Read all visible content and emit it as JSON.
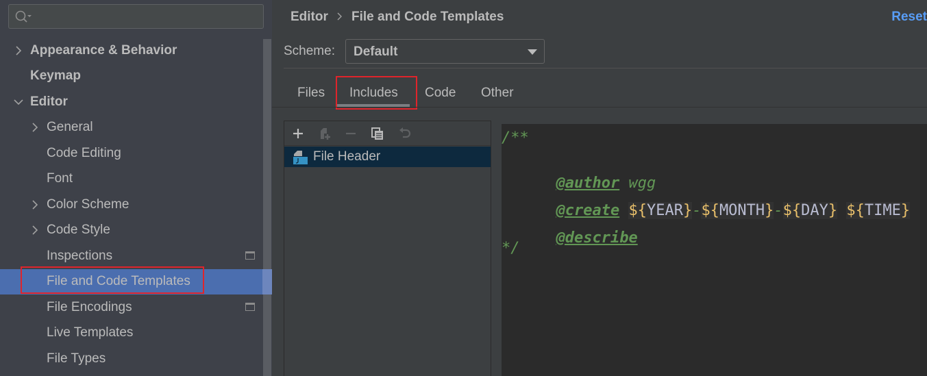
{
  "sidebar": {
    "search": {
      "placeholder": "",
      "value": ""
    },
    "items": [
      {
        "label": "Appearance & Behavior",
        "level": 0,
        "expandable": true,
        "expanded": false,
        "bold": true
      },
      {
        "label": "Keymap",
        "level": 0,
        "expandable": false,
        "bold": true
      },
      {
        "label": "Editor",
        "level": 0,
        "expandable": true,
        "expanded": true,
        "bold": true
      },
      {
        "label": "General",
        "level": 1,
        "expandable": true,
        "expanded": false
      },
      {
        "label": "Code Editing",
        "level": 1,
        "expandable": false
      },
      {
        "label": "Font",
        "level": 1,
        "expandable": false
      },
      {
        "label": "Color Scheme",
        "level": 1,
        "expandable": true,
        "expanded": false
      },
      {
        "label": "Code Style",
        "level": 1,
        "expandable": true,
        "expanded": false
      },
      {
        "label": "Inspections",
        "level": 1,
        "expandable": false,
        "project_icon": true
      },
      {
        "label": "File and Code Templates",
        "level": 1,
        "expandable": false,
        "selected": true
      },
      {
        "label": "File Encodings",
        "level": 1,
        "expandable": false,
        "project_icon": true
      },
      {
        "label": "Live Templates",
        "level": 1,
        "expandable": false
      },
      {
        "label": "File Types",
        "level": 1,
        "expandable": false
      }
    ]
  },
  "header": {
    "breadcrumb": [
      "Editor",
      "File and Code Templates"
    ],
    "reset_label": "Reset"
  },
  "scheme": {
    "label": "Scheme:",
    "value": "Default"
  },
  "tabs": [
    {
      "label": "Files",
      "active": false
    },
    {
      "label": "Includes",
      "active": true
    },
    {
      "label": "Code",
      "active": false
    },
    {
      "label": "Other",
      "active": false
    }
  ],
  "toolbar": {
    "buttons": [
      "add-icon",
      "copy-template-icon",
      "remove-icon",
      "duplicate-icon",
      "reset-icon"
    ]
  },
  "templates": [
    {
      "name": "File Header",
      "selected": true,
      "icon": "java-file-icon"
    }
  ],
  "editor": {
    "lines": [
      {
        "comment": "/**"
      },
      {
        "tag": "@author",
        "text": " wgg"
      },
      {
        "tag": "@create",
        "vars": [
          "YEAR",
          "MONTH",
          "DAY",
          "TIME"
        ],
        "separators": [
          "-",
          "-",
          " "
        ]
      },
      {
        "tag": "@describe"
      },
      {
        "comment": "*/"
      }
    ]
  },
  "colors": {
    "selection": "#4b6eaf",
    "link": "#589df6",
    "highlight_box": "#e0242b",
    "comment": "#629755",
    "template_var": "#e8bf6a"
  }
}
